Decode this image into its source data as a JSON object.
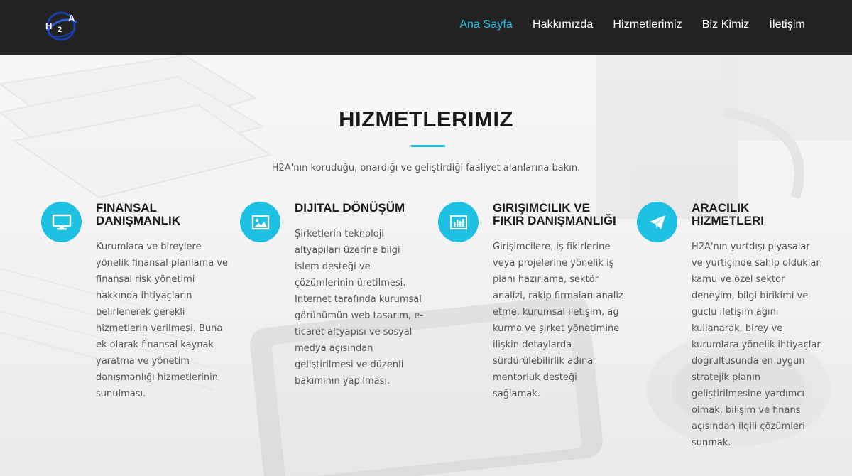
{
  "header": {
    "logo": {
      "text_h": "H",
      "text_2": "2",
      "text_a": "A"
    },
    "nav": [
      {
        "label": "Ana Sayfa",
        "active": true
      },
      {
        "label": "Hakkımızda",
        "active": false
      },
      {
        "label": "Hizmetlerimiz",
        "active": false
      },
      {
        "label": "Biz Kimiz",
        "active": false
      },
      {
        "label": "İletişim",
        "active": false
      }
    ]
  },
  "section": {
    "title": "HIZMETLERIMIZ",
    "subtitle": "H2A'nın koruduğu, onardığı ve geliştirdiği faaliyet alanlarına bakın."
  },
  "services": [
    {
      "icon": "monitor-icon",
      "title": "FINANSAL DANIŞMANLIK",
      "text": "Kurumlara ve bireylere yönelik finansal planlama ve finansal risk yönetimi hakkında ihtiyaçların belirlenerek gerekli hizmetlerin verilmesi. Buna ek olarak finansal kaynak yaratma ve yönetim danışmanlığı hizmetlerinin sunulması."
    },
    {
      "icon": "image-icon",
      "title": "DIJITAL DÖNÜŞÜM",
      "text": "Şirketlerin teknoloji altyapıları üzerine bilgi işlem desteği ve çözümlerinin üretilmesi. Internet tarafında kurumsal görünümün web tasarım, e-ticaret altyapısı ve sosyal medya açısından geliştirilmesi ve düzenli bakımının yapılması."
    },
    {
      "icon": "bar-chart-icon",
      "title": "GIRIŞIMCILIK VE FIKIR DANIŞMANLIĞI",
      "text": "Girişimcilere, iş fikirlerine veya projelerine yönelik iş planı hazırlama, sektör analizi, rakip firmaları analiz etme, kurumsal iletişim, ağ kurma ve şirket yönetimine ilişkin detaylarda sürdürülebilirlik adına mentorluk desteği sağlamak."
    },
    {
      "icon": "paper-plane-icon",
      "title": "ARACILIK HIZMETLERI",
      "text": "H2A'nın yurtdışı piyasalar ve yurtiçinde sahip oldukları kamu ve özel sektor deneyim, bilgi birikimi ve guclu iletişim ağını kullanarak, birey ve kurumlara yönelik ihtiyaçlar doğrultusunda en uygun stratejik planın geliştirilmesine yardımcı olmak, bilişim ve finans açısından ilgili çözümleri sunmak."
    }
  ],
  "colors": {
    "accent": "#1ec0e4",
    "header_bg": "#222222",
    "title": "#1a1a1a",
    "text": "#555555"
  }
}
